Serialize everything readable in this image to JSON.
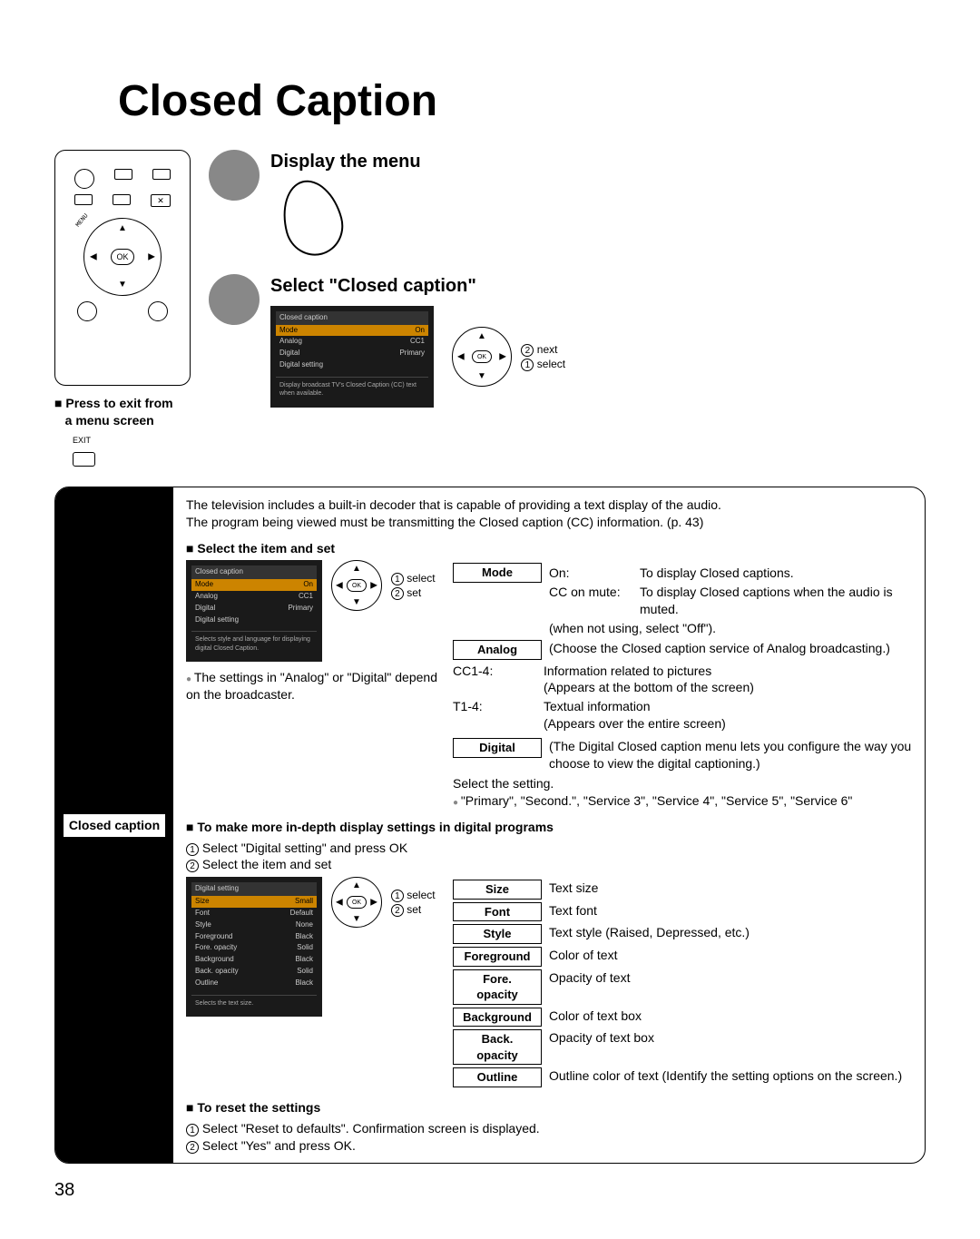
{
  "page_title": "Closed Caption",
  "page_number": "38",
  "step1": {
    "title": "Display the menu"
  },
  "step2": {
    "title": "Select \"Closed caption\"",
    "osd": {
      "header": "Closed caption",
      "rows": [
        {
          "label": "Mode",
          "value": "On",
          "hl": true
        },
        {
          "label": "Analog",
          "value": "CC1"
        },
        {
          "label": "Digital",
          "value": "Primary"
        },
        {
          "label": "Digital setting",
          "value": ""
        }
      ],
      "desc": "Display broadcast TV's Closed Caption (CC) text when available."
    },
    "nav": {
      "l2": "next",
      "l1": "select"
    }
  },
  "exit": {
    "line1": "Press to exit from",
    "line2": "a menu screen",
    "btn": "EXIT"
  },
  "cc": {
    "side_label": "Closed caption",
    "intro1": "The television includes a built-in decoder that is capable of providing a text display of the audio.",
    "intro2": "The program being viewed must be transmitting the Closed caption (CC) information. (p. 43)",
    "h_select": "Select the item and set",
    "osd_small": {
      "header": "Closed caption",
      "rows": [
        {
          "label": "Mode",
          "value": "On",
          "hl": true
        },
        {
          "label": "Analog",
          "value": "CC1"
        },
        {
          "label": "Digital",
          "value": "Primary"
        },
        {
          "label": "Digital setting",
          "value": ""
        }
      ],
      "desc": "Selects style and language for displaying digital Closed Caption."
    },
    "nav_small": {
      "l1": "select",
      "l2": "set"
    },
    "note_analog": "The settings in \"Analog\" or \"Digital\" depend on the broadcaster.",
    "mode": {
      "label": "Mode",
      "on_k": "On:",
      "on_v": "To display Closed captions.",
      "mute_k": "CC on mute:",
      "mute_v": "To display Closed captions when the audio is muted.",
      "off": "(when not using, select \"Off\")."
    },
    "analog": {
      "label": "Analog",
      "desc": "(Choose the Closed caption service of Analog broadcasting.)",
      "cc14_k": "CC1-4:",
      "cc14_v1": "Information related to pictures",
      "cc14_v2": "(Appears at the bottom of the screen)",
      "t14_k": "T1-4:",
      "t14_v1": "Textual information",
      "t14_v2": "(Appears over the entire screen)"
    },
    "digital": {
      "label": "Digital",
      "desc": "(The Digital Closed caption menu lets you configure the way you choose to view the digital captioning.)",
      "sel": "Select the setting.",
      "opts": "\"Primary\", \"Second.\", \"Service 3\", \"Service 4\", \"Service 5\", \"Service 6\""
    },
    "h_digital": "To make more in-depth display settings in digital programs",
    "dig_step1": "Select \"Digital setting\" and press OK",
    "dig_step2": "Select the item and set",
    "osd_dig": {
      "header": "Digital setting",
      "rows": [
        {
          "label": "Size",
          "value": "Small",
          "hl": true
        },
        {
          "label": "Font",
          "value": "Default"
        },
        {
          "label": "Style",
          "value": "None"
        },
        {
          "label": "Foreground",
          "value": "Black"
        },
        {
          "label": "Fore. opacity",
          "value": "Solid"
        },
        {
          "label": "Background",
          "value": "Black"
        },
        {
          "label": "Back. opacity",
          "value": "Solid"
        },
        {
          "label": "Outline",
          "value": "Black"
        }
      ],
      "desc": "Selects the text size."
    },
    "opts": [
      {
        "label": "Size",
        "desc": "Text size"
      },
      {
        "label": "Font",
        "desc": "Text font"
      },
      {
        "label": "Style",
        "desc": "Text style (Raised, Depressed, etc.)"
      },
      {
        "label": "Foreground",
        "desc": "Color of text"
      },
      {
        "label": "Fore. opacity",
        "desc": "Opacity of text"
      },
      {
        "label": "Background",
        "desc": "Color of text box"
      },
      {
        "label": "Back. opacity",
        "desc": "Opacity of text box"
      },
      {
        "label": "Outline",
        "desc": "Outline color of text (Identify the setting options on the screen.)"
      }
    ],
    "h_reset": "To reset the settings",
    "reset1": "Select \"Reset to defaults\". Confirmation screen is displayed.",
    "reset2": "Select \"Yes\" and press OK."
  }
}
